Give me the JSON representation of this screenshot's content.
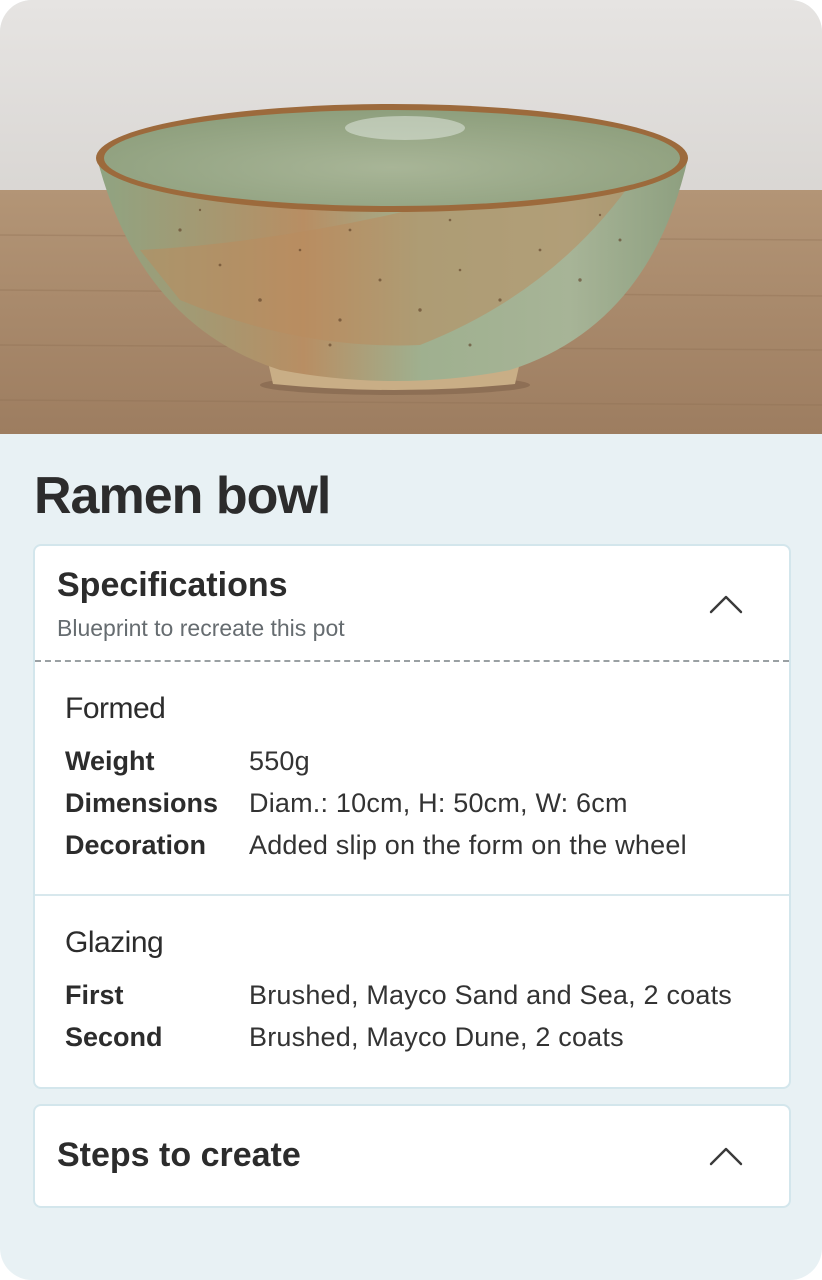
{
  "product": {
    "title": "Ramen bowl"
  },
  "specifications": {
    "title": "Specifications",
    "subtitle": "Blueprint to recreate this pot",
    "sections": [
      {
        "title": "Formed",
        "rows": [
          {
            "key": "Weight",
            "value": "550g"
          },
          {
            "key": "Dimensions",
            "value": "Diam.: 10cm, H: 50cm, W: 6cm"
          },
          {
            "key": "Decoration",
            "value": "Added slip on the form on the wheel"
          }
        ]
      },
      {
        "title": "Glazing",
        "rows": [
          {
            "key": "First",
            "value": "Brushed, Mayco Sand and Sea, 2 coats"
          },
          {
            "key": "Second",
            "value": "Brushed, Mayco Dune, 2 coats"
          }
        ]
      }
    ]
  },
  "steps": {
    "title": "Steps to create"
  },
  "icons": {
    "collapse": "chevron-up-icon"
  },
  "colors": {
    "background": "#e8f1f4",
    "panel_border": "#d3e6ec",
    "text": "#2c2c2c"
  }
}
